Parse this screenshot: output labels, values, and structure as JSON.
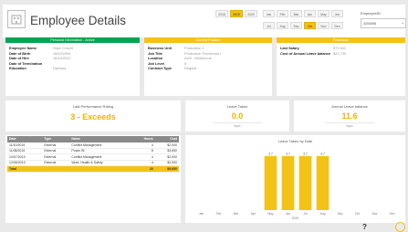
{
  "header": {
    "title": "Employee Details",
    "years": [
      {
        "label": "2018",
        "selected": false
      },
      {
        "label": "2019",
        "selected": true
      },
      {
        "label": "2020",
        "selected": false
      }
    ],
    "months_row1": [
      {
        "label": "Jan",
        "selected": false
      },
      {
        "label": "Feb",
        "selected": false
      },
      {
        "label": "Mar",
        "selected": false
      },
      {
        "label": "Apr",
        "selected": false
      },
      {
        "label": "May",
        "selected": false
      },
      {
        "label": "Jun",
        "selected": false
      }
    ],
    "months_row2": [
      {
        "label": "Jul",
        "selected": false
      },
      {
        "label": "Aug",
        "selected": false
      },
      {
        "label": "Sep",
        "selected": false
      },
      {
        "label": "Oct",
        "selected": true
      },
      {
        "label": "Nov",
        "selected": false
      },
      {
        "label": "Dec",
        "selected": false
      }
    ],
    "employee_slicer_label": "EmployeeID",
    "employee_slicer_value": "3200598",
    "accent_color": "#f3c217"
  },
  "personal": {
    "title": "Personal Information - Active",
    "color": "#00a651",
    "rows": [
      {
        "label": "Employee Name",
        "value": "Skye Colcott"
      },
      {
        "label": "Date of Birth",
        "value": "16/02/1994"
      },
      {
        "label": "Date of Hire",
        "value": "16/10/2012"
      },
      {
        "label": "Date of Termination",
        "value": ""
      },
      {
        "label": "Education",
        "value": "Diploma"
      }
    ]
  },
  "position": {
    "title": "Current Position",
    "color": "#f3c217",
    "rows": [
      {
        "label": "Business Unit",
        "value": "Production 1"
      },
      {
        "label": "Job Title",
        "value": "Production Technician I"
      },
      {
        "label": "Location",
        "value": "AUS - Melbourne"
      },
      {
        "label": "Job Level",
        "value": "5"
      },
      {
        "label": "Contract Type",
        "value": "Regular"
      }
    ]
  },
  "financials": {
    "title": "Financials",
    "color": "#f3c217",
    "rows": [
      {
        "label": "Last Salary",
        "value": "$70,541"
      },
      {
        "label": "Cost of Annual Leave balance",
        "value": "$22,730"
      }
    ]
  },
  "kpis": {
    "performance": {
      "title": "Last Performance Rating",
      "value": "3 - Exceeds"
    },
    "leave_taken": {
      "title": "Leave Taken",
      "value": "0.0",
      "unit": "days"
    },
    "annual_leave": {
      "title": "Annual Leave balance",
      "value": "11.6",
      "unit": "days"
    }
  },
  "training_table": {
    "headers": [
      "Date",
      "Type",
      "Name",
      "Hours",
      "Cost"
    ],
    "rows": [
      [
        "11/10/2019",
        "External",
        "Conflict Management",
        "4",
        "$2,000"
      ],
      [
        "11/08/2019",
        "External",
        "Power BI",
        "8",
        "$3,650"
      ],
      [
        "10/07/2019",
        "External",
        "Conflict Management",
        "4",
        "$2,000"
      ],
      [
        "12/06/2019",
        "External",
        "Work, Health & Safety",
        "4",
        "$2,000"
      ]
    ],
    "total": [
      "Total",
      "",
      "",
      "20",
      "$9,650"
    ]
  },
  "chart_data": {
    "type": "bar",
    "title": "Leave Taken by Date",
    "categories": [
      "Jan",
      "Feb",
      "Mar",
      "Apr",
      "May",
      "Jun",
      "Jul",
      "Aug",
      "Sep",
      "Oct",
      "Nov",
      "Dec"
    ],
    "values": [
      0,
      0,
      0,
      0,
      3.7,
      3.7,
      3.7,
      3.7,
      0,
      0,
      0,
      0
    ],
    "data_labels": [
      "",
      "",
      "",
      "",
      "3.7",
      "3.7",
      "3.7",
      "3.7",
      "",
      "",
      "",
      ""
    ],
    "xlabel": "2019",
    "ylim": [
      0,
      4
    ],
    "bar_color": "#f3c217"
  }
}
